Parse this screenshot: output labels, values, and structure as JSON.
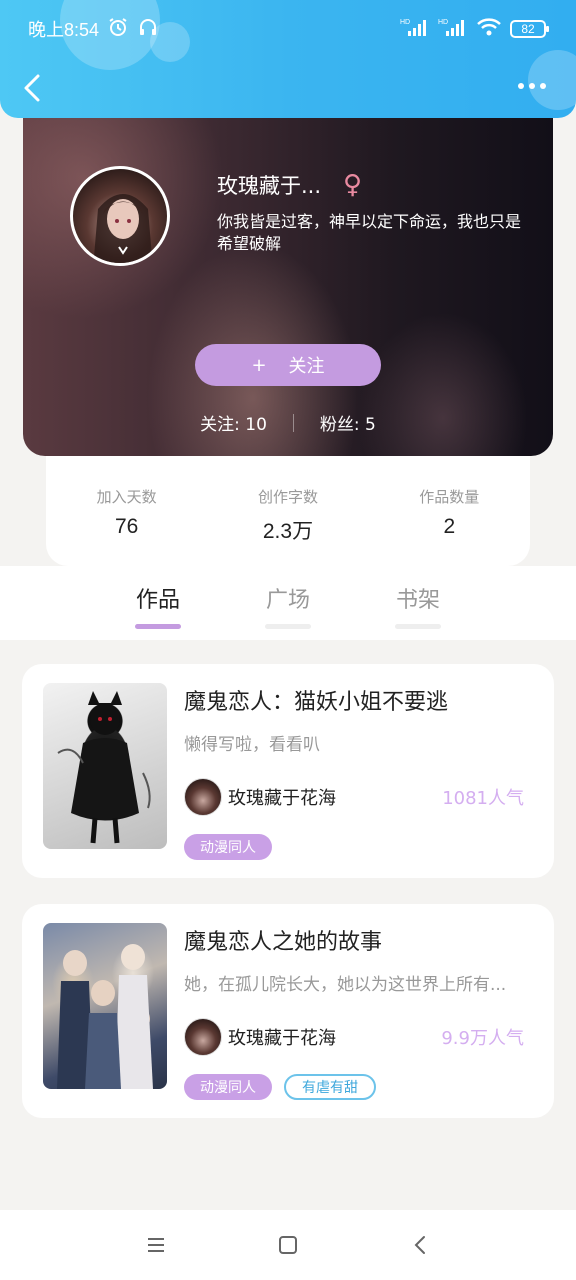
{
  "status_bar": {
    "time": "晚上8:54",
    "battery": "82",
    "signal1_label": "HD",
    "signal2_label": "HD"
  },
  "profile": {
    "username": "玫瑰藏于...",
    "gender_symbol": "♀",
    "bio": "你我皆是过客，神早以定下命运，我也只是希望破解",
    "follow_button": "关注",
    "follow_plus": "+",
    "following_label": "关注: 10",
    "fans_label": "粉丝: 5"
  },
  "stats": [
    {
      "label": "加入天数",
      "value": "76"
    },
    {
      "label": "创作字数",
      "value": "2.3万"
    },
    {
      "label": "作品数量",
      "value": "2"
    }
  ],
  "tabs": [
    {
      "label": "作品",
      "active": true
    },
    {
      "label": "广场",
      "active": false
    },
    {
      "label": "书架",
      "active": false
    }
  ],
  "works": [
    {
      "title": "魔鬼恋人：猫妖小姐不要逃",
      "description": "懒得写啦，看看叭",
      "author": "玫瑰藏于花海",
      "popularity": "1081人气",
      "tags": [
        "动漫同人"
      ]
    },
    {
      "title": "魔鬼恋人之她的故事",
      "description": "她，在孤儿院长大，她以为这世界上所有...",
      "author": "玫瑰藏于花海",
      "popularity": "9.9万人气",
      "tags": [
        "动漫同人",
        "有虐有甜"
      ]
    }
  ],
  "colors": {
    "header_blue": "#3bb5f0",
    "accent_purple": "#c49be0",
    "popularity_purple": "#d4aef0",
    "tag_outline_blue": "#6cc3ea"
  }
}
